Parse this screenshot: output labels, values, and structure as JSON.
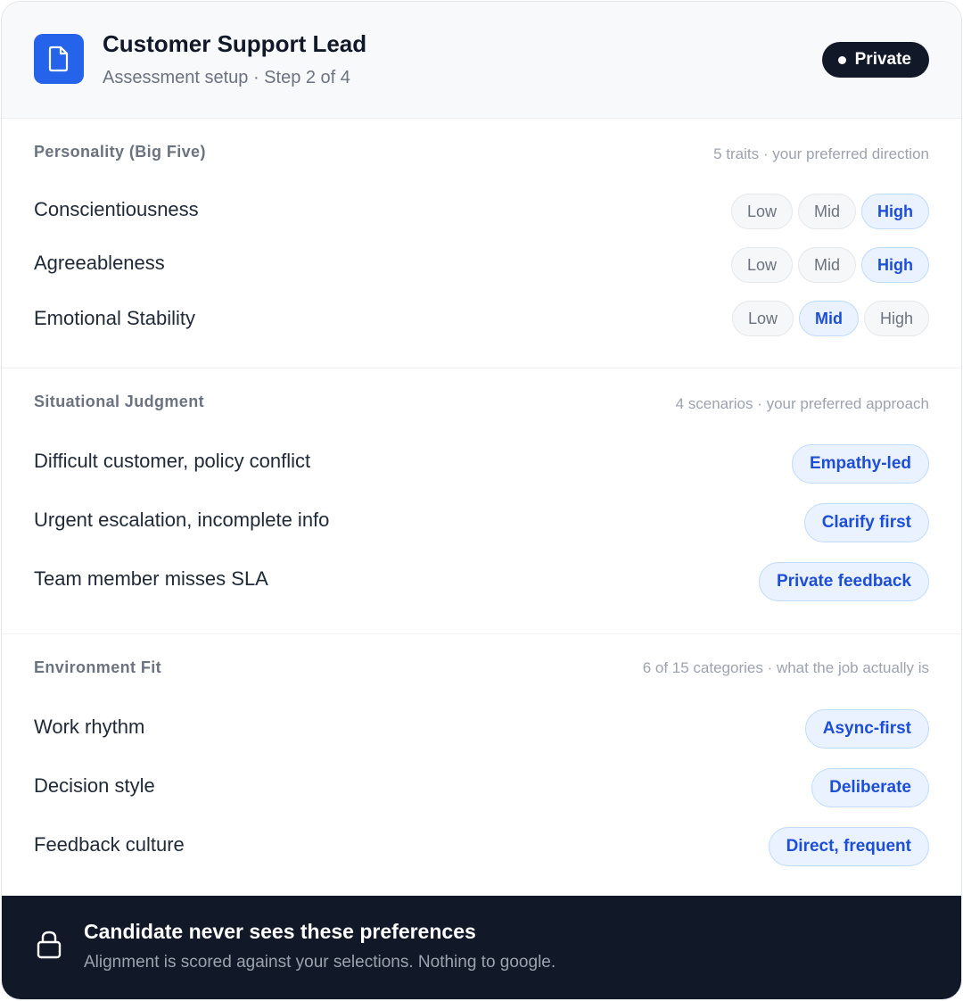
{
  "header": {
    "title": "Customer Support Lead",
    "subtitle": "Assessment setup · Step 2 of 4",
    "badge": "Private",
    "icon": "document-icon",
    "accent": "#2563eb"
  },
  "personality": {
    "title": "Personality (Big Five)",
    "meta": "5 traits · your preferred direction",
    "traits": [
      {
        "label": "Conscientiousness",
        "options": [
          "Low",
          "Mid",
          "High"
        ],
        "selected": "High"
      },
      {
        "label": "Agreeableness",
        "options": [
          "Low",
          "Mid",
          "High"
        ],
        "selected": "High"
      },
      {
        "label": "Emotional Stability",
        "options": [
          "Low",
          "Mid",
          "High"
        ],
        "selected": "Mid"
      }
    ]
  },
  "judgment": {
    "title": "Situational Judgment",
    "meta": "4 scenarios · your preferred approach",
    "rows": [
      {
        "label": "Difficult customer, policy conflict",
        "value": "Empathy-led"
      },
      {
        "label": "Urgent escalation, incomplete info",
        "value": "Clarify first"
      },
      {
        "label": "Team member misses SLA",
        "value": "Private feedback"
      }
    ]
  },
  "environment": {
    "title": "Environment Fit",
    "meta": "6 of 15 categories · what the job actually is",
    "rows": [
      {
        "label": "Work rhythm",
        "value": "Async-first"
      },
      {
        "label": "Decision style",
        "value": "Deliberate"
      },
      {
        "label": "Feedback culture",
        "value": "Direct, frequent"
      }
    ]
  },
  "footer": {
    "title": "Candidate never sees these preferences",
    "text": "Alignment is scored against your selections. Nothing to google.",
    "icon": "lock-icon"
  },
  "colors": {
    "selected_text": "#1d4ed8",
    "selected_bg": "#eaf2ff",
    "footer_bg": "#111827"
  }
}
